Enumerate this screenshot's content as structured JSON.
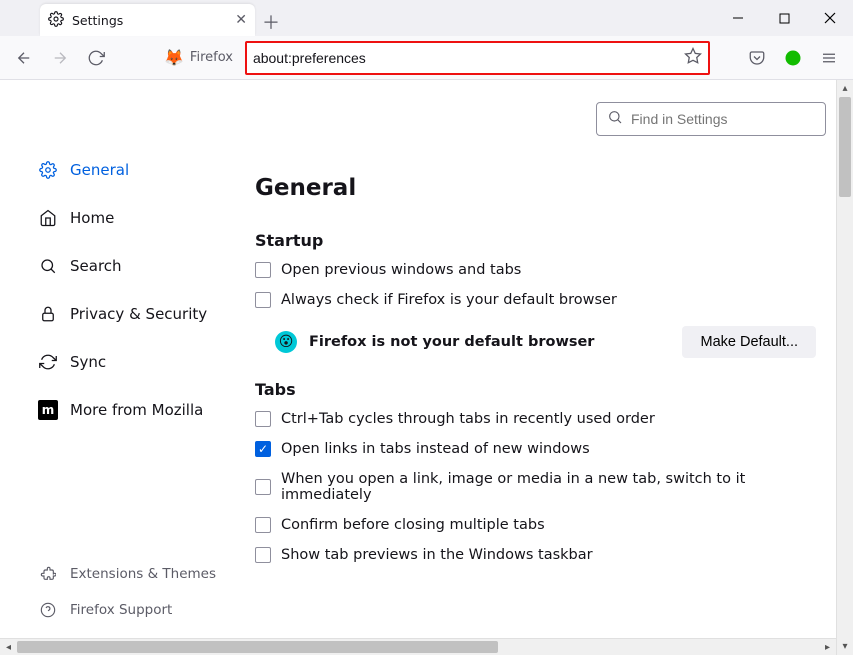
{
  "window": {
    "tab_title": "Settings"
  },
  "toolbar": {
    "identity_label": "Firefox",
    "url": "about:preferences"
  },
  "sidebar": {
    "items": [
      {
        "label": "General"
      },
      {
        "label": "Home"
      },
      {
        "label": "Search"
      },
      {
        "label": "Privacy & Security"
      },
      {
        "label": "Sync"
      },
      {
        "label": "More from Mozilla"
      }
    ],
    "footer": [
      {
        "label": "Extensions & Themes"
      },
      {
        "label": "Firefox Support"
      }
    ]
  },
  "search": {
    "placeholder": "Find in Settings"
  },
  "page": {
    "title": "General",
    "startup": {
      "heading": "Startup",
      "open_previous": "Open previous windows and tabs",
      "always_check": "Always check if Firefox is your default browser",
      "status": "Firefox is not your default browser",
      "make_default": "Make Default..."
    },
    "tabs": {
      "heading": "Tabs",
      "ctrl_tab": "Ctrl+Tab cycles through tabs in recently used order",
      "open_links": "Open links in tabs instead of new windows",
      "switch_immediately": "When you open a link, image or media in a new tab, switch to it immediately",
      "confirm_close": "Confirm before closing multiple tabs",
      "taskbar_previews": "Show tab previews in the Windows taskbar"
    }
  }
}
